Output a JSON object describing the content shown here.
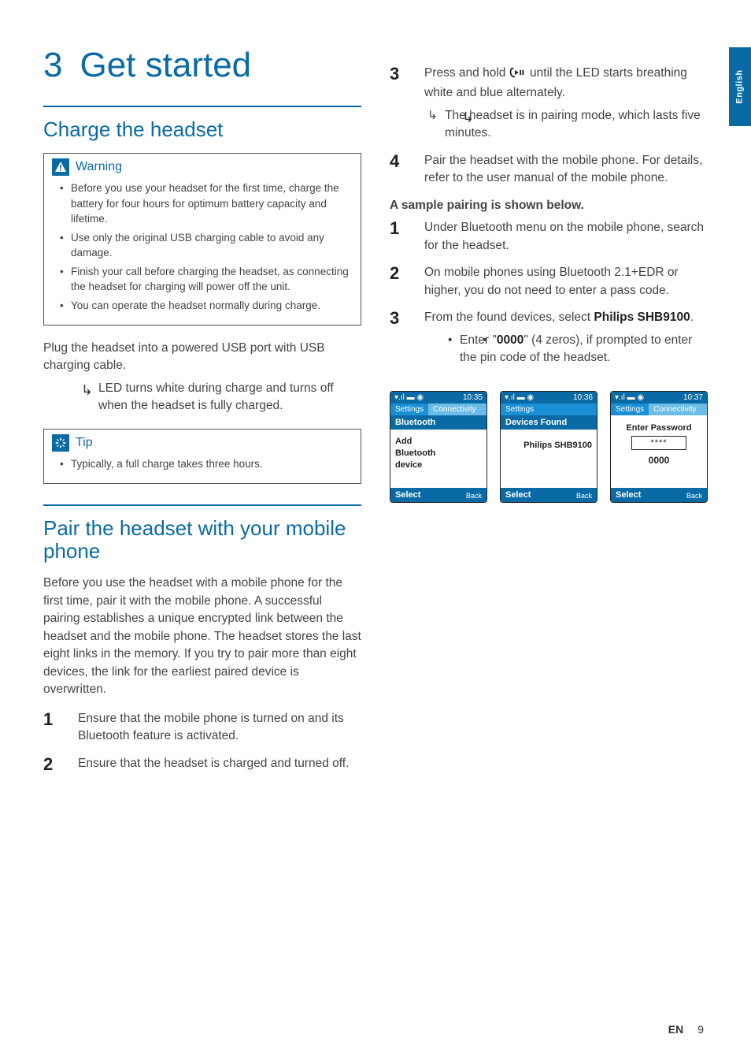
{
  "side_tab": "English",
  "chapter": {
    "number": "3",
    "title": "Get started"
  },
  "section_charge": {
    "title": "Charge the headset",
    "warning_label": "Warning",
    "warnings": [
      "Before you use your headset for the first time, charge the battery for four hours for optimum battery capacity and lifetime.",
      "Use only the original USB charging cable to avoid any damage.",
      "Finish your call before charging the headset, as connecting the headset for charging will power off the unit.",
      "You can operate the headset normally during charge."
    ],
    "body": "Plug the headset into a powered USB port with USB charging cable.",
    "result": "LED turns white during charge and turns off when the headset is fully charged.",
    "tip_label": "Tip",
    "tips": [
      "Typically, a full charge takes three hours."
    ]
  },
  "section_pair": {
    "title": "Pair the headset with your mobile phone",
    "intro": "Before you use the headset with a mobile phone for the first time, pair it with the mobile phone. A successful pairing establishes a unique encrypted link between the headset and the mobile phone. The headset stores the last eight links in the memory. If you try to pair more than eight devices, the link for the earliest paired device is overwritten.",
    "steps_a": [
      "Ensure that the mobile phone is turned on and its Bluetooth feature is activated.",
      "Ensure that the headset is charged and turned off."
    ],
    "step3_pre": "Press and hold ",
    "step3_post": " until the LED starts breathing white and blue alternately.",
    "step3_result": "The headset is in pairing mode, which lasts five minutes.",
    "step4": "Pair the headset with the mobile phone. For details, refer to the user manual of the mobile phone.",
    "sample_heading": "A sample pairing is shown below.",
    "sample_steps": [
      "Under Bluetooth menu on the mobile phone, search for the headset.",
      "On mobile phones using Bluetooth 2.1+EDR or higher, you do not need to enter a pass code."
    ],
    "sample_step3_pre": "From the found devices, select ",
    "sample_device": "Philips SHB9100",
    "sample_step3_post": ".",
    "sample_pin_pre": "Enter \"",
    "sample_pin": "0000",
    "sample_pin_post": "\" (4 zeros), if prompted to enter the pin code of the headset."
  },
  "phones": [
    {
      "time": "10:35",
      "crumb1": "Settings",
      "crumb2": "Connectivity",
      "title": "Bluetooth",
      "body": "Add Bluetooth device",
      "select": "Select",
      "back": "Back"
    },
    {
      "time": "10:36",
      "crumb1": "Settings",
      "crumb2": "",
      "title": "Devices Found",
      "body": "Philips SHB9100",
      "select": "Select",
      "back": "Back"
    },
    {
      "time": "10:37",
      "crumb1": "Settings",
      "crumb2": "Connectivity",
      "enter_label": "Enter Password",
      "input": "****",
      "pin": "0000",
      "select": "Select",
      "back": "Back"
    }
  ],
  "footer": {
    "lang": "EN",
    "page": "9"
  }
}
